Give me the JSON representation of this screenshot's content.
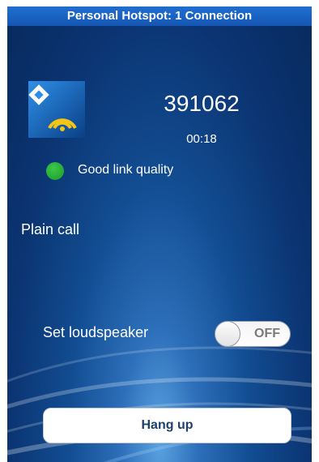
{
  "status_bar": {
    "text": "Personal Hotspot: 1 Connection",
    "color": "#1a63c4"
  },
  "app_logo": {
    "icon": "wifi-logo-icon"
  },
  "call": {
    "number": "391062",
    "duration": "00:18",
    "link_quality": {
      "label": "Good link quality",
      "indicator_color": "#22a832"
    },
    "type": "Plain call"
  },
  "loudspeaker": {
    "label": "Set loudspeaker",
    "toggle_state": "OFF"
  },
  "actions": {
    "hang_up_label": "Hang up"
  },
  "colors": {
    "background_dark": "#082a5e",
    "background_light": "#5aa3e0",
    "text": "#ffffff",
    "button_text": "#1f3f6c"
  }
}
